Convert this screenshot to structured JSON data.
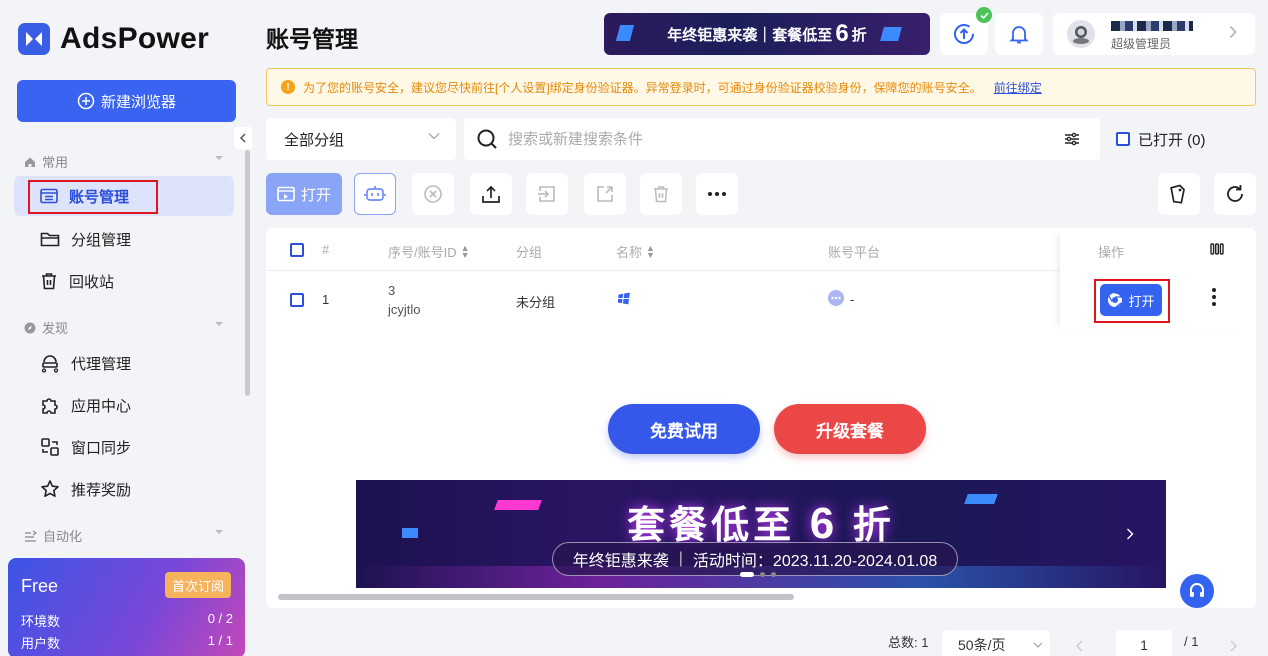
{
  "app": {
    "brand": "AdsPower",
    "accent": "#3a63f2"
  },
  "sidebar": {
    "new_browser": "新建浏览器",
    "sections": {
      "common": "常用",
      "discover": "发现",
      "automation": "自动化"
    },
    "items": {
      "accounts": "账号管理",
      "groups": "分组管理",
      "trash": "回收站",
      "proxy": "代理管理",
      "apps": "应用中心",
      "sync": "窗口同步",
      "referral": "推荐奖励"
    },
    "plan": {
      "name": "Free",
      "subscribe": "首次订阅",
      "env_label": "环境数",
      "env_value": "0 / 2",
      "users_label": "用户数",
      "users_value": "1 / 1"
    }
  },
  "header": {
    "title": "账号管理",
    "promo_prefix": "年终钜惠来袭｜套餐低至",
    "promo_number": "6",
    "promo_suffix": "折",
    "user_role": "超级管理员"
  },
  "alert": {
    "text": "为了您的账号安全，建议您尽快前往[个人设置]绑定身份验证器。异常登录时，可通过身份验证器校验身份，保障您的账号安全。",
    "link": "前往绑定"
  },
  "filters": {
    "group_value": "全部分组",
    "search_placeholder": "搜索或新建搜索条件",
    "opened_label": "已打开 (0)"
  },
  "toolbar": {
    "open_label": "打开"
  },
  "table": {
    "headers": {
      "index": "#",
      "serial": "序号/账号ID",
      "group": "分组",
      "name": "名称",
      "platform": "账号平台",
      "ops": "操作"
    },
    "rows": [
      {
        "index": "1",
        "serial": "3",
        "account_id": "jcyjtlo",
        "group": "未分组",
        "platform": "-",
        "open": "打开"
      }
    ]
  },
  "cta": {
    "trial": "免费试用",
    "upgrade": "升级套餐"
  },
  "banner": {
    "headline_pre": "套餐低至",
    "headline_num": "6",
    "headline_post": "折",
    "sub_left": "年终钜惠来袭",
    "sub_right": "活动时间：2023.11.20-2024.01.08"
  },
  "pagination": {
    "total": "总数: 1",
    "page_size": "50条/页",
    "current": "1",
    "pages": "/ 1"
  }
}
